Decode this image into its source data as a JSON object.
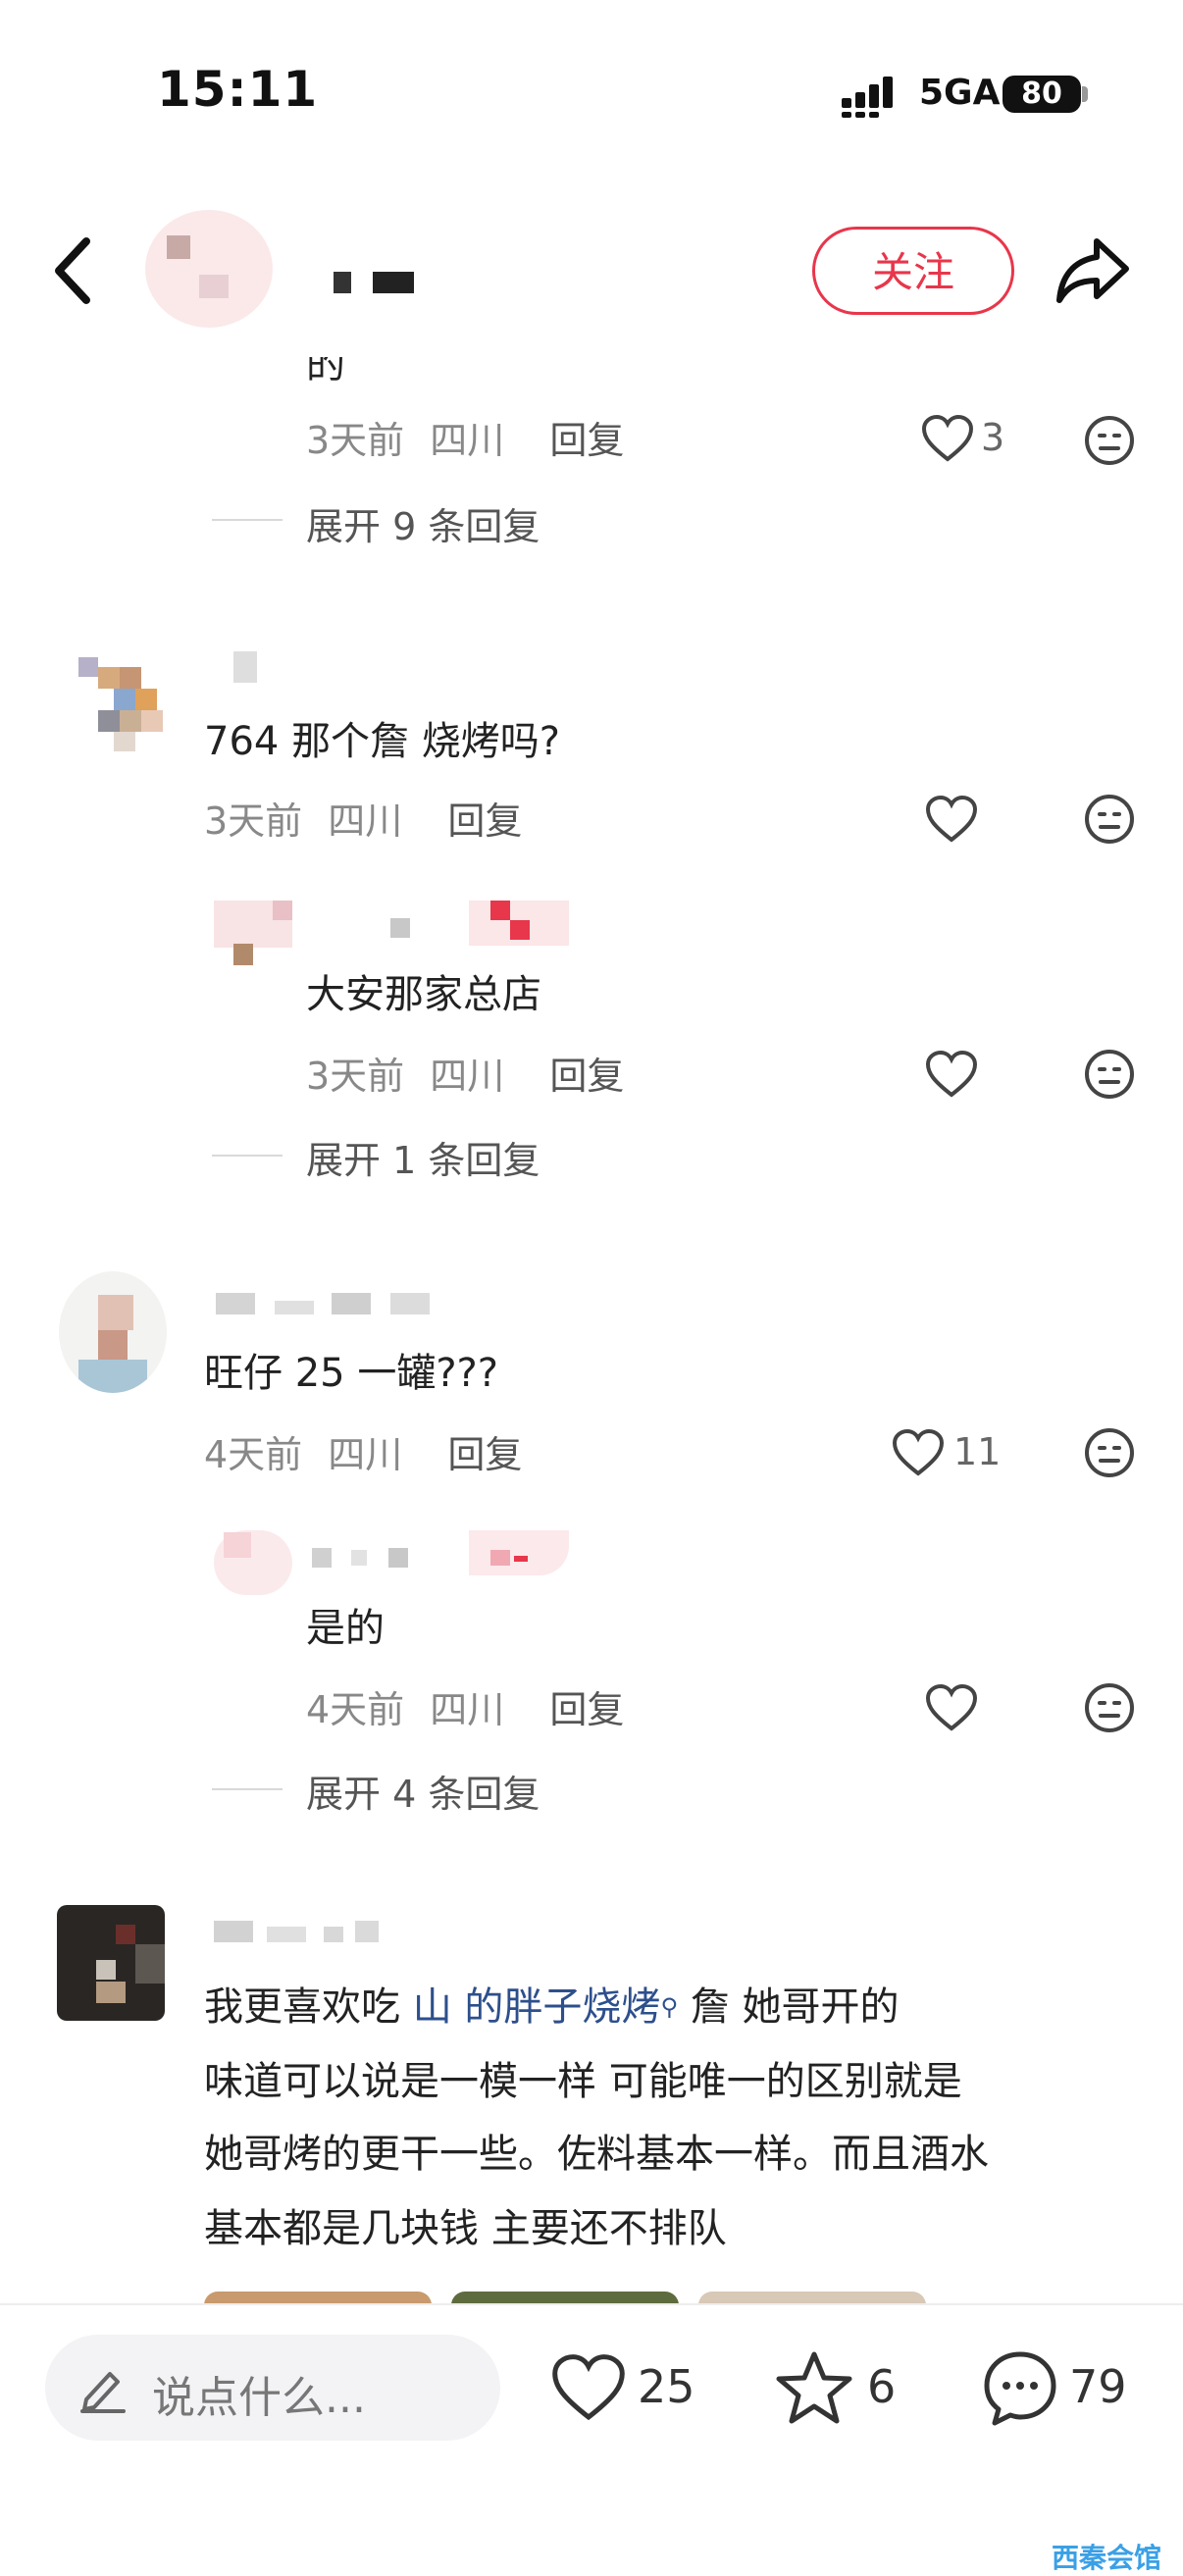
{
  "status": {
    "time": "15:11",
    "network": "5GA",
    "battery": "80"
  },
  "header": {
    "follow_label": "关注"
  },
  "comments": [
    {
      "tail_text": "的",
      "meta": {
        "age": "3天前",
        "location": "四川",
        "reply": "回复"
      },
      "likes": "3",
      "expand": "展开 9 条回复"
    },
    {
      "text": "764 那个詹 烧烤吗?",
      "meta": {
        "age": "3天前",
        "location": "四川",
        "reply": "回复"
      },
      "likes": "",
      "sub": {
        "text": "大安那家总店",
        "meta": {
          "age": "3天前",
          "location": "四川",
          "reply": "回复"
        },
        "likes": "",
        "expand": "展开 1 条回复"
      }
    },
    {
      "text": "旺仔 25 一罐???",
      "meta": {
        "age": "4天前",
        "location": "四川",
        "reply": "回复"
      },
      "likes": "11",
      "sub": {
        "text": "是的",
        "meta": {
          "age": "4天前",
          "location": "四川",
          "reply": "回复"
        },
        "likes": "",
        "expand": "展开 4 条回复"
      }
    },
    {
      "text_prefix": "我更喜欢吃 ",
      "link": "山 的胖子烧烤",
      "text_line1_rest": " 詹 她哥开的",
      "lines": [
        "味道可以说是一模一样  可能唯一的区别就是",
        "她哥烤的更干一些。佐料基本一样。而且酒水",
        "基本都是几块钱 主要还不排队"
      ]
    }
  ],
  "bottom_bar": {
    "input_placeholder": "说点什么...",
    "likes": "25",
    "stars": "6",
    "comments": "79"
  },
  "watermark": "西秦会馆",
  "colors": {
    "accent": "#e8364b",
    "link": "#2d4f8c",
    "meta": "#888888"
  },
  "icons": [
    "back-icon",
    "share-icon",
    "heart-icon",
    "dislike-face-icon",
    "pencil-icon",
    "star-icon",
    "comment-bubble-icon"
  ]
}
